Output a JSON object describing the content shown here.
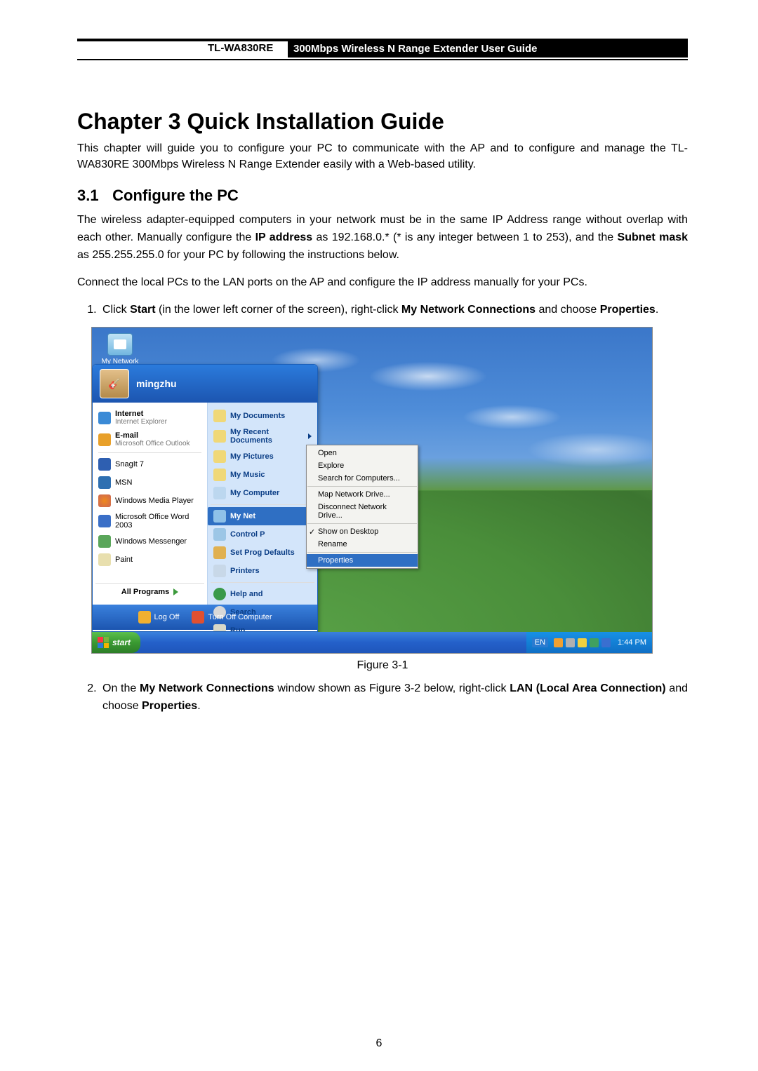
{
  "header": {
    "model": "TL-WA830RE",
    "title": "300Mbps Wireless N Range Extender User Guide"
  },
  "chapter_title": "Chapter 3   Quick Installation Guide",
  "intro": "This chapter will guide you to configure your PC to communicate with the AP and to configure and manage the TL-WA830RE 300Mbps Wireless N Range Extender easily with a Web-based utility.",
  "section_num": "3.1",
  "section_title": "Configure the PC",
  "p1_a": "The wireless adapter-equipped computers in your network must be in the same IP Address range without overlap with each other. Manually configure the ",
  "p1_b": "IP address",
  "p1_c": " as 192.168.0.* (* is any integer between 1 to 253), and the ",
  "p1_d": "Subnet mask",
  "p1_e": " as 255.255.255.0 for your PC by following the instructions below.",
  "p2": "Connect the local PCs to the LAN ports on the AP and configure the IP address manually for your PCs.",
  "step1_a": "Click ",
  "step1_b": "Start",
  "step1_c": " (in the lower left corner of the screen), right-click ",
  "step1_d": "My Network Connections",
  "step1_e": " and choose ",
  "step1_f": "Properties",
  "step1_g": ".",
  "fig_caption": "Figure 3-1",
  "step2_a": "On the ",
  "step2_b": "My Network Connections",
  "step2_c": " window shown as Figure 3-2 below, right-click ",
  "step2_d": "LAN (Local Area Connection)",
  "step2_e": " and choose ",
  "step2_f": "Properties",
  "step2_g": ".",
  "page_number": "6",
  "screenshot": {
    "desktop_icon": "My Network Places",
    "user": "mingzhu",
    "left_items": [
      {
        "t": "Internet",
        "s": "Internet Explorer"
      },
      {
        "t": "E-mail",
        "s": "Microsoft Office Outlook"
      },
      {
        "t": "SnagIt 7"
      },
      {
        "t": "MSN"
      },
      {
        "t": "Windows Media Player"
      },
      {
        "t": "Microsoft Office Word 2003"
      },
      {
        "t": "Windows Messenger"
      },
      {
        "t": "Paint"
      }
    ],
    "all_programs": "All Programs",
    "right_items": [
      "My Documents",
      "My Recent Documents",
      "My Pictures",
      "My Music",
      "My Computer",
      "My Net",
      "Control P",
      "Set Prog Defaults",
      "Printers",
      "Help and",
      "Search",
      "Run..."
    ],
    "right_selected_index": 5,
    "footer": {
      "logoff": "Log Off",
      "turnoff": "Turn Off Computer"
    },
    "context": [
      "Open",
      "Explore",
      "Search for Computers...",
      "Map Network Drive...",
      "Disconnect Network Drive...",
      "Show on Desktop",
      "Rename",
      "Properties"
    ],
    "context_checked_index": 5,
    "context_selected_index": 7,
    "taskbar": {
      "start": "start",
      "lang": "EN",
      "time": "1:44 PM"
    }
  }
}
